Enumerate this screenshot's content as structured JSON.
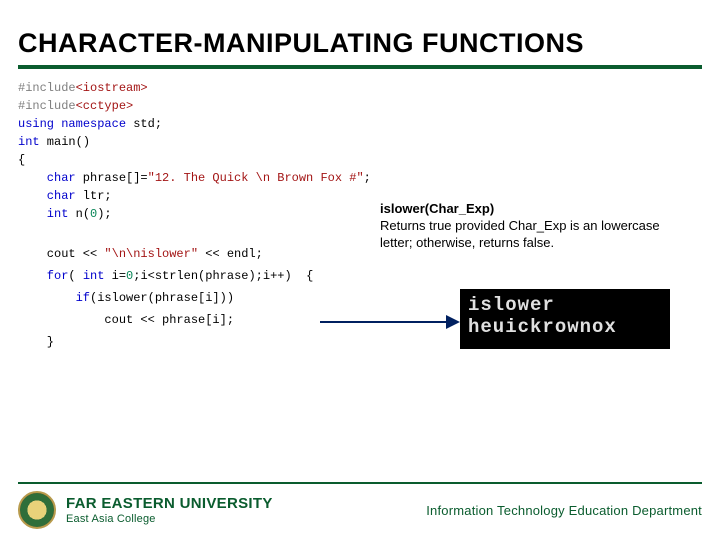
{
  "title": "CHARACTER-MANIPULATING FUNCTIONS",
  "code": {
    "l1a": "#include",
    "l1b": "<iostream>",
    "l2a": "#include",
    "l2b": "<cctype>",
    "l3a": "using",
    "l3b": " namespace",
    "l3c": " std;",
    "l4a": "int",
    "l4b": " main()",
    "l5": "{",
    "l6a": "    char",
    "l6b": " phrase[]=",
    "l6c": "\"12. The Quick \\n Brown Fox #\"",
    "l6d": ";",
    "l7a": "    char",
    "l7b": " ltr;",
    "l8a": "    int",
    "l8b": " n(",
    "l8c": "0",
    "l8d": ");",
    "l9a": "    cout << ",
    "l9b": "\"\\n\\nislower\"",
    "l9c": " << endl;",
    "l10a": "    for",
    "l10b": "(",
    "l10c": " int",
    "l10d": " i=",
    "l10e": "0",
    "l10f": ";i<strlen(phrase);i++)  {",
    "l11": "        if",
    "l11b": "(islower(phrase[i]))",
    "l12": "            cout << phrase[i];",
    "l13": "    }"
  },
  "callout": {
    "sig": "islower(Char_Exp)",
    "desc": "Returns true provided Char_Exp is an lowercase letter; otherwise, returns false."
  },
  "terminal": {
    "line1": "islower",
    "line2": "heuickrownox"
  },
  "footer": {
    "uni_name": "FAR EASTERN UNIVERSITY",
    "uni_sub": "East Asia College",
    "dept": "Information Technology Education Department"
  }
}
